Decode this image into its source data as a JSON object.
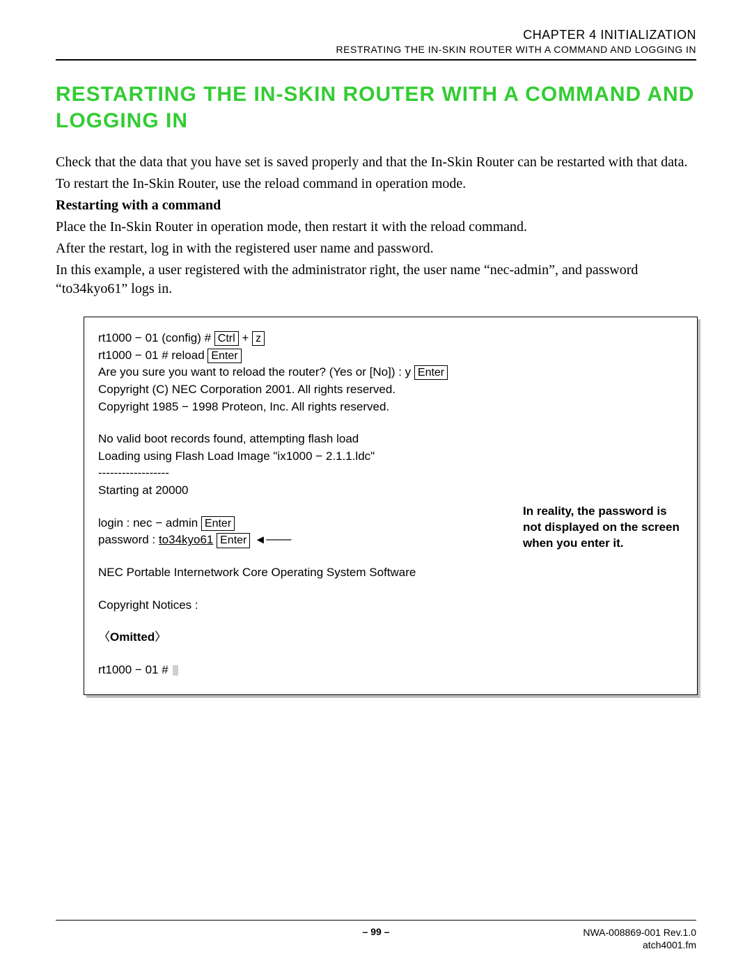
{
  "header": {
    "chapter": "CHAPTER 4   INITIALIZATION",
    "section": "RESTRATING THE IN-SKIN ROUTER WITH A COMMAND AND LOGGING IN"
  },
  "title": "RESTARTING THE IN-SKIN ROUTER WITH A COMMAND AND LOGGING IN",
  "para1": "Check that the data that you have set is saved properly and that the In-Skin Router can be restarted with that data.",
  "para2": "To restart the In-Skin Router, use the reload command in operation mode.",
  "subhead": "Restarting with a command",
  "para3": "Place the In-Skin Router in operation mode, then restart it with the reload command.",
  "para4": "After the restart, log in with the registered user name and password.",
  "para5": "In this example, a user registered with the administrator right, the user name “nec-admin”, and password “to34kyo61” logs in.",
  "terminal": {
    "l1a": "rt1000 − 01 (config) # ",
    "key_ctrl": "Ctrl",
    "plus": " + ",
    "key_z": "z",
    "l2a": "rt1000 − 01 # reload ",
    "key_enter": "Enter",
    "l3a": "Are you sure you want to reload the router? (Yes or [No]) : y ",
    "l4": "Copyright (C) NEC Corporation 2001. All rights reserved.",
    "l5": "Copyright 1985 − 1998 Proteon, Inc. All rights reserved.",
    "l6": "No valid boot records found, attempting flash load",
    "l7": "Loading using Flash Load Image \"ix1000 − 2.1.1.ldc\"",
    "l8": "------------------",
    "l9": "Starting at 20000",
    "l10a": "login : nec − admin ",
    "l11a": "password : ",
    "l11b": "to34kyo61",
    "l12": "NEC Portable Internetwork Core Operating System Software",
    "l13": "Copyright Notices :",
    "omitted_open": "〈",
    "omitted": "Omitted",
    "omitted_close": "〉",
    "l15": "rt1000 − 01 # ",
    "annotation": "In reality, the password is not displayed on the screen when you enter it."
  },
  "footer": {
    "page": "– 99 –",
    "doc": "NWA-008869-001 Rev.1.0",
    "file": "atch4001.fm"
  }
}
